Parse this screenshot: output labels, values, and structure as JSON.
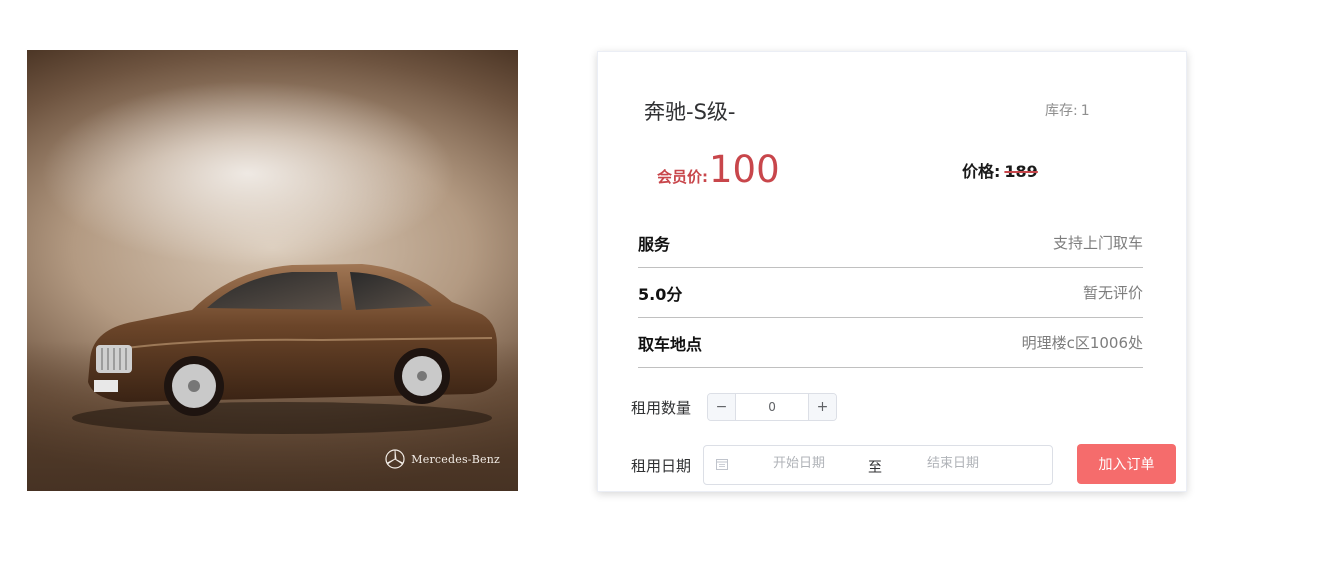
{
  "product": {
    "image_alt": "Mercedes-Benz S-Class",
    "brand_watermark": "Mercedes-Benz",
    "title": "奔驰-S级-",
    "stock_label": "库存:",
    "stock_value": "1",
    "member_price_label": "会员价:",
    "member_price_value": "100",
    "price_label": "价格:",
    "price_value": "189",
    "colors": {
      "member_price": "#c8464b",
      "order_button": "#f56c6c"
    }
  },
  "info_rows": [
    {
      "label": "服务",
      "value": "支持上门取车"
    },
    {
      "label": "5.0分",
      "value": "暂无评价"
    },
    {
      "label": "取车地点",
      "value": "明理楼c区1006处"
    }
  ],
  "rental": {
    "quantity_label": "租用数量",
    "quantity_value": "0",
    "minus_symbol": "−",
    "plus_symbol": "+",
    "date_label": "租用日期",
    "start_placeholder": "开始日期",
    "range_separator": "至",
    "end_placeholder": "结束日期",
    "calendar_icon": "calendar-icon"
  },
  "actions": {
    "add_to_order": "加入订单"
  }
}
